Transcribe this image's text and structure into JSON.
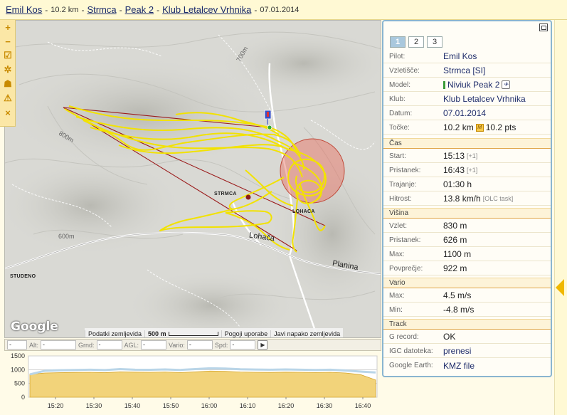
{
  "header": {
    "pilot": "Emil Kos",
    "distance": "10.2 km",
    "separator": "-",
    "takeoff": "Strmca",
    "glider": "Peak 2",
    "club": "Klub Letalcev Vrhnika",
    "date": "07.01.2014"
  },
  "map_tools": [
    {
      "name": "zoom-in-icon",
      "glyph": "+"
    },
    {
      "name": "zoom-out-icon",
      "glyph": "−"
    },
    {
      "name": "checklist-icon",
      "glyph": "☑"
    },
    {
      "name": "gear-icon",
      "glyph": "✲"
    },
    {
      "name": "layers-icon",
      "glyph": "☗"
    },
    {
      "name": "warning-icon",
      "glyph": "⚠"
    },
    {
      "name": "close-icon",
      "glyph": "×"
    }
  ],
  "map": {
    "places": {
      "strmca": "STRMCA",
      "lohaca": "LOHACA",
      "studeno": "STUDENO"
    },
    "roads": {
      "lohaca": "Lohača",
      "planina": "Planina"
    },
    "contours": {
      "c800": "800m",
      "c600": "600m",
      "c700": "700m"
    },
    "google": "Google",
    "footer": {
      "map_data": "Podatki zemljevida",
      "scale": "500 m",
      "terms": "Pogoji uporabe",
      "report": "Javi napako zemljevida"
    },
    "colors": {
      "track": "#f2e200",
      "line": "#9b1c1c",
      "circle": "#e96a5a"
    }
  },
  "fields": [
    {
      "label": "",
      "value": "-"
    },
    {
      "label": "Alt:",
      "value": "-"
    },
    {
      "label": "Grnd:",
      "value": "-"
    },
    {
      "label": "AGL:",
      "value": "-"
    },
    {
      "label": "Vario:",
      "value": "-"
    },
    {
      "label": "Spd:",
      "value": "-"
    }
  ],
  "chart_data": {
    "type": "area",
    "title": "",
    "xlabel": "",
    "ylabel": "",
    "x_ticks": [
      "15:20",
      "15:30",
      "15:40",
      "15:50",
      "16:00",
      "16:10",
      "16:20",
      "16:30",
      "16:40"
    ],
    "y_ticks": [
      "1500",
      "1000",
      "500",
      "0"
    ],
    "ylim": [
      0,
      1500
    ],
    "series": [
      {
        "values": [
          830,
          960,
          980,
          990,
          1000,
          985,
          1020,
          1000,
          995,
          1010,
          990,
          1020,
          1050,
          1040,
          1015,
          1005,
          1000,
          1010,
          1000,
          990,
          1000,
          970,
          930,
          900
        ]
      },
      {
        "values": [
          830,
          880,
          890,
          900,
          905,
          890,
          920,
          910,
          905,
          915,
          895,
          920,
          950,
          940,
          915,
          905,
          900,
          910,
          905,
          895,
          905,
          880,
          820,
          626
        ]
      }
    ],
    "colors": {
      "ground": "#f2d37a",
      "track": "#b9d5e8"
    }
  },
  "panel": {
    "tabs": [
      "1",
      "2",
      "3"
    ],
    "rows1": [
      {
        "k": "Pilot:",
        "v": "Emil Kos"
      },
      {
        "k": "Vzletišče:",
        "v": "Strmca [SI]"
      },
      {
        "k": "Model:",
        "v": "Niviuk Peak 2"
      },
      {
        "k": "Klub:",
        "v": "Klub Letalcev Vrhnika"
      },
      {
        "k": "Datum:",
        "v": "07.01.2014"
      },
      {
        "k": "Točke:",
        "v": "10.2 km",
        "v2": "10.2 pts",
        "icon": "M"
      }
    ],
    "sections": {
      "cas": "Čas",
      "visina": "Višina",
      "vario": "Vario",
      "track": "Track"
    },
    "cas": [
      {
        "k": "Start:",
        "v": "15:13",
        "t": "[+1]"
      },
      {
        "k": "Pristanek:",
        "v": "16:43",
        "t": "[+1]"
      },
      {
        "k": "Trajanje:",
        "v": "01:30 h"
      },
      {
        "k": "Hitrost:",
        "v": "13.8 km/h",
        "t": "[OLC task]"
      }
    ],
    "visina": [
      {
        "k": "Vzlet:",
        "v": "830 m"
      },
      {
        "k": "Pristanek:",
        "v": "626 m"
      },
      {
        "k": "Max:",
        "v": "1100 m"
      },
      {
        "k": "Povprečje:",
        "v": "922 m"
      }
    ],
    "vario": [
      {
        "k": "Max:",
        "v": "4.5 m/s"
      },
      {
        "k": "Min:",
        "v": "-4.8 m/s"
      }
    ],
    "track": [
      {
        "k": "G record:",
        "v": "OK"
      },
      {
        "k": "IGC datoteka:",
        "v": "prenesi"
      },
      {
        "k": "Google Earth:",
        "v": "KMZ file"
      }
    ]
  }
}
